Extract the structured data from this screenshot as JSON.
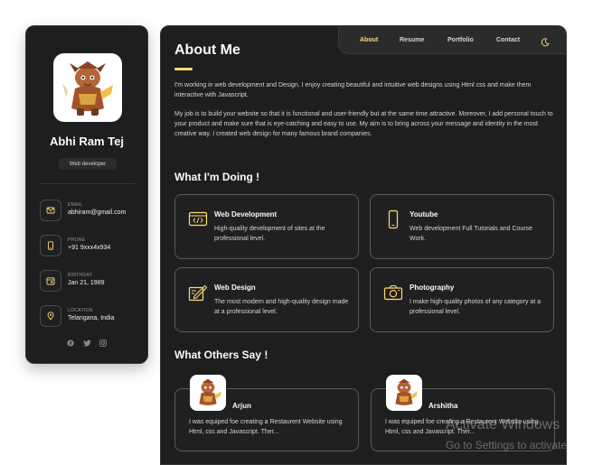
{
  "sidebar": {
    "name": "Abhi Ram Tej",
    "title": "Web developer",
    "contacts": [
      {
        "label": "Email",
        "value": "abhiram@gmail.com",
        "icon": "mail-icon"
      },
      {
        "label": "Phone",
        "value": "+91 9xxx4x934",
        "icon": "phone-icon"
      },
      {
        "label": "Birthday",
        "value": "Jan 21, 1989",
        "icon": "calendar-icon"
      },
      {
        "label": "Location",
        "value": "Telangana, India",
        "icon": "location-icon"
      }
    ],
    "socials": [
      "facebook-icon",
      "twitter-icon",
      "instagram-icon"
    ]
  },
  "navbar": {
    "items": [
      "About",
      "Resume",
      "Portfolio",
      "Contact"
    ],
    "active": "About"
  },
  "about": {
    "title": "About Me",
    "paragraphs": [
      "I'm working in web development and Design. I enjoy creating beautiful and intuitive web designs using Html css and make them interactive with Javascript.",
      "My job is to build your website so that it is functional and user-friendly but at the same time attractive. Moreover, I add personal touch to your product and make sure that is eye-catching and easy to use. My aim is to bring across your message and identity in the most creative way. I created web design for many famous brand companies."
    ]
  },
  "services": {
    "title": "What I'm Doing !",
    "items": [
      {
        "title": "Web Development",
        "desc": "High-quality development of sites at the professional level.",
        "icon": "code-window-icon"
      },
      {
        "title": "Youtube",
        "desc": "Web development Full Tutorials and Course Work.",
        "icon": "mobile-phone-icon"
      },
      {
        "title": "Web Design",
        "desc": "The most modern and high-quality design made at a professional level.",
        "icon": "design-pen-icon"
      },
      {
        "title": "Photography",
        "desc": "I make high-quality photos of any category at a professional level.",
        "icon": "camera-icon"
      }
    ]
  },
  "testimonials": {
    "title": "What Others Say !",
    "items": [
      {
        "name": "Arjun",
        "text": "I was equiped foe creating a Restaurent Website using Html, css and Javascript. Ther..."
      },
      {
        "name": "Arshitha",
        "text": "I was equiped foe creating a Restaurent Website using Html, css and Javascript. Ther..."
      }
    ]
  },
  "watermark": {
    "line1": "Activate Windows",
    "line2": "Go to Settings to activate"
  },
  "colors": {
    "accent": "#ffdb70",
    "background": "#1e1e1f",
    "navbar": "#2b2b2c"
  }
}
